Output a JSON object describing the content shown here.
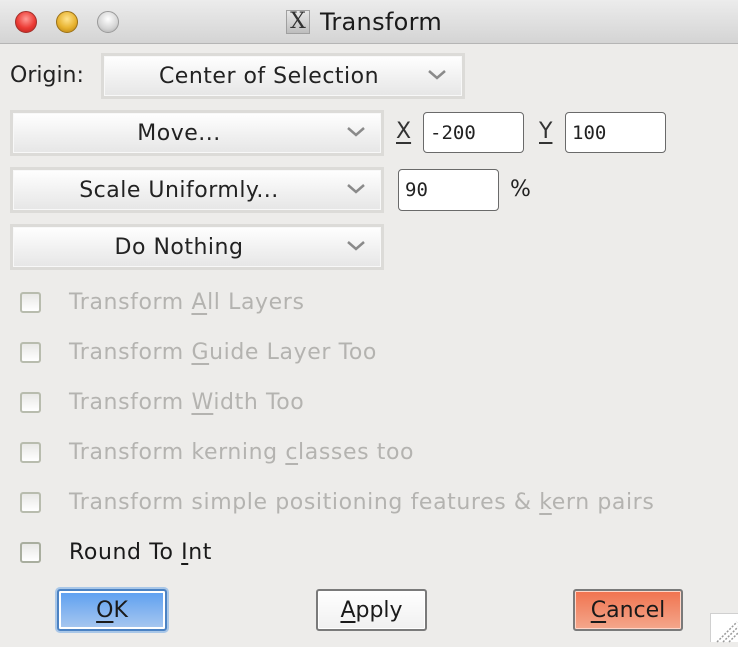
{
  "window": {
    "title": "Transform",
    "app_icon": "x11-icon",
    "controls": [
      "close",
      "minimize",
      "maximize"
    ]
  },
  "origin": {
    "label": "Origin:",
    "selected": "Center of Selection"
  },
  "transforms": [
    {
      "selected": "Move...",
      "x_label": "X",
      "x_value": "-200",
      "y_label": "Y",
      "y_value": "100"
    },
    {
      "selected": "Scale Uniformly...",
      "value": "90",
      "unit": "%"
    },
    {
      "selected": "Do Nothing"
    }
  ],
  "options": [
    {
      "pre": "Transform ",
      "mnemonic": "A",
      "post": "ll Layers",
      "checked": false,
      "enabled": false
    },
    {
      "pre": "Transform ",
      "mnemonic": "G",
      "post": "uide Layer Too",
      "checked": false,
      "enabled": false
    },
    {
      "pre": "Transform ",
      "mnemonic": "W",
      "post": "idth Too",
      "checked": false,
      "enabled": false
    },
    {
      "pre": "Transform kerning ",
      "mnemonic": "c",
      "post": "lasses too",
      "checked": false,
      "enabled": false
    },
    {
      "pre": "Transform simple positioning features & ",
      "mnemonic": "k",
      "post": "ern pairs",
      "checked": false,
      "enabled": false
    },
    {
      "pre": "Round To ",
      "mnemonic": "I",
      "post": "nt",
      "checked": false,
      "enabled": true
    }
  ],
  "buttons": {
    "ok": {
      "mnemonic": "O",
      "rest": "K"
    },
    "apply": {
      "mnemonic": "A",
      "rest": "pply"
    },
    "cancel": {
      "mnemonic": "C",
      "rest": "ancel"
    }
  },
  "colors": {
    "ok_button": "#6fa7ef",
    "cancel_button": "#f28a6a",
    "disabled_text": "#b4b3b0"
  }
}
